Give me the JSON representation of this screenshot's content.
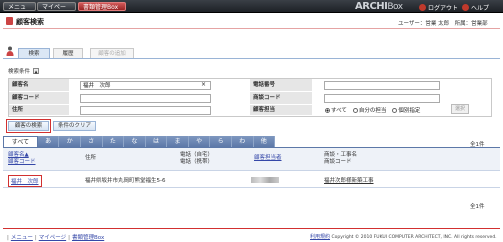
{
  "topbar": {
    "menu": "メニュー",
    "mypage": "マイページ",
    "docs": "書類管理Box",
    "logo_main": "ARCHI",
    "logo_sub": "Box",
    "logout": "ログアウト",
    "help": "ヘルプ"
  },
  "header": {
    "title": "顧客検索",
    "user": "ユーザー：営業 太郎　所属：営業部"
  },
  "tabs": [
    "検索",
    "履歴",
    "顧客の追加"
  ],
  "conditions": {
    "heading": "検索条件",
    "toggle": "▲",
    "name_label": "顧客名",
    "name_value": "福井　次郎",
    "name_clear": "×",
    "code_label": "顧客コード",
    "address_label": "住所",
    "phone_label": "電話番号",
    "property_code_label": "商談コード",
    "staff_label": "顧客担当",
    "radios": [
      "すべて",
      "自分の担当",
      "個別指定"
    ],
    "select_button": "選択"
  },
  "buttons": {
    "search": "顧客の検索",
    "clear": "条件のクリア"
  },
  "kana": [
    "すべて",
    "あ",
    "か",
    "さ",
    "た",
    "な",
    "は",
    "ま",
    "や",
    "ら",
    "わ",
    "他"
  ],
  "count_label": "全1件",
  "results": {
    "col1a": "顧客名▲",
    "col1b": "顧客コード",
    "col2": "住所",
    "col3a": "電話（自宅）",
    "col3b": "電話（携帯）",
    "col4": "顧客担当者",
    "col5a": "商談・工事名",
    "col5b": "商談コード",
    "row": {
      "name": "福井　次郎",
      "address": "福井県坂井市丸岡町熊堂福生5-6",
      "project": "福井次郎様新築工事"
    }
  },
  "footer": {
    "menu": "メニュー",
    "mypage": "マイページ",
    "docs": "書類管理Box",
    "terms": "利用規約",
    "copyright": "Copyright © 2010 FUKUI COMPUTER ARCHITECT, INC. All rights reserved."
  }
}
